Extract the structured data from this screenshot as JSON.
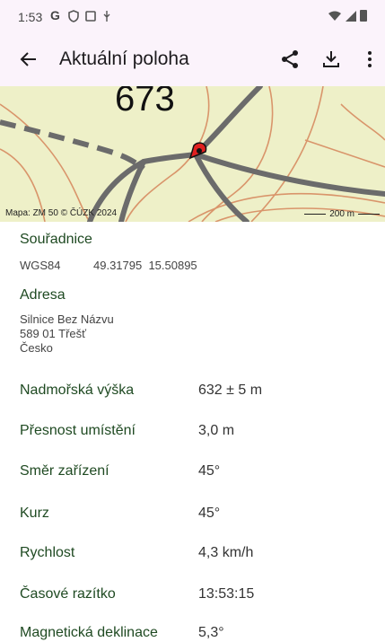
{
  "status_bar": {
    "time": "1:53",
    "icons": [
      "google-g-icon",
      "shield-icon",
      "square-icon",
      "usb-icon",
      "wifi-icon",
      "signal-icon",
      "battery-icon"
    ]
  },
  "app_bar": {
    "title": "Aktuální poloha",
    "actions": [
      "back-arrow-icon",
      "share-icon",
      "download-icon",
      "more-vert-icon"
    ]
  },
  "map": {
    "elevation_label": "673",
    "attribution": "Mapa: ZM 50 © ČÚZK 2024",
    "scale": "200 m",
    "colors": {
      "background": "#eef0c8",
      "contour": "#d9956b",
      "road": "#6b6b6b",
      "marker": "#e02020"
    }
  },
  "coordinates": {
    "heading": "Souřadnice",
    "system": "WGS84",
    "value": "49.31795  15.50895"
  },
  "address": {
    "heading": "Adresa",
    "lines": [
      "Silnice Bez Názvu",
      "589 01 Třešť",
      "Česko"
    ]
  },
  "details": [
    {
      "label": "Nadmořská výška",
      "value": "632 ± 5 m"
    },
    {
      "label": "Přesnost umístění",
      "value": "3,0 m"
    },
    {
      "label": "Směr zařízení",
      "value": "45°"
    },
    {
      "label": "Kurz",
      "value": "45°"
    },
    {
      "label": "Rychlost",
      "value": "4,3 km/h"
    },
    {
      "label": "Časové razítko",
      "value": "13:53:15"
    },
    {
      "label": "Magnetická deklinace",
      "value": "5,3°"
    }
  ],
  "colors": {
    "accent": "#1f4a22",
    "appbar": "#fbf3fb"
  }
}
